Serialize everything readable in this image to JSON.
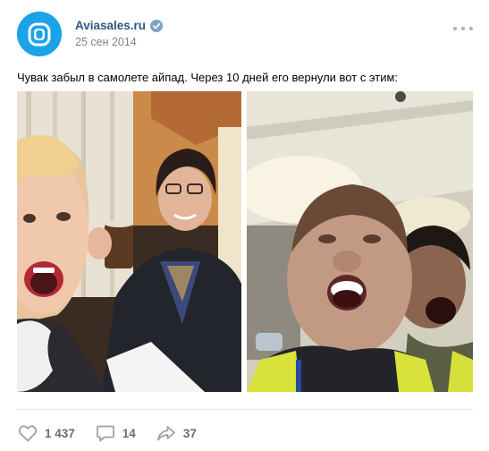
{
  "post": {
    "author": "Aviasales.ru",
    "date": "25 сен 2014",
    "text": "Чувак забыл в самолете айпад. Через 10 дней его вернули вот с этим:",
    "colors": {
      "link": "#2a5885",
      "meta": "#828282",
      "accent": "#1aa3e8",
      "action": "#626d7a"
    }
  },
  "icons": {
    "avatar": "aviasales-logo-icon",
    "verified": "verified-check-icon",
    "more": "more-horizontal-icon",
    "like": "heart-icon",
    "comment": "comment-bubble-icon",
    "share": "share-arrow-icon"
  },
  "actions": {
    "likes": "1 437",
    "comments": "14",
    "shares": "37"
  }
}
